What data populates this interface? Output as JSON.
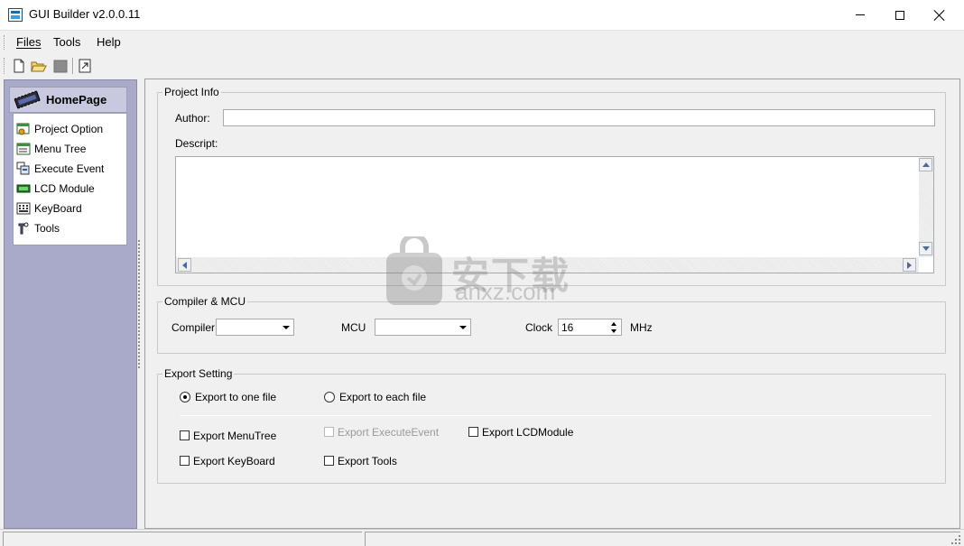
{
  "window": {
    "title": "GUI Builder v2.0.0.11"
  },
  "menu": {
    "items": [
      "Files",
      "Tools",
      "Help"
    ]
  },
  "toolbar": {
    "buttons": [
      "new-file-icon",
      "open-folder-icon",
      "save-icon",
      "export-icon"
    ]
  },
  "sidebar": {
    "header": "HomePage",
    "items": [
      {
        "label": "Project Option",
        "icon": "project-option-icon"
      },
      {
        "label": "Menu Tree",
        "icon": "menu-tree-icon"
      },
      {
        "label": "Execute Event",
        "icon": "execute-event-icon"
      },
      {
        "label": "LCD Module",
        "icon": "lcd-module-icon"
      },
      {
        "label": "KeyBoard",
        "icon": "keyboard-icon"
      },
      {
        "label": "Tools",
        "icon": "tools-icon"
      }
    ]
  },
  "project_info": {
    "title": "Project Info",
    "author_label": "Author:",
    "author_value": "",
    "descript_label": "Descript:",
    "descript_value": ""
  },
  "compiler_mcu": {
    "title": "Compiler & MCU",
    "compiler_label": "Compiler",
    "compiler_value": "",
    "mcu_label": "MCU",
    "mcu_value": "",
    "clock_label": "Clock",
    "clock_value": "16",
    "clock_unit": "MHz"
  },
  "export_setting": {
    "title": "Export Setting",
    "radio_one": "Export to one file",
    "radio_each": "Export to each file",
    "selected": "one",
    "checks": {
      "menutree": "Export MenuTree",
      "executeevent": "Export ExecuteEvent",
      "lcdmodule": "Export LCDModule",
      "keyboard": "Export KeyBoard",
      "tools": "Export Tools"
    }
  },
  "watermark": {
    "text": "安下载",
    "url": "anxz.com"
  },
  "colors": {
    "sidebar_bg": "#a9aac9",
    "header_bg": "#c8c9de",
    "window_bg": "#f0f0f0"
  }
}
